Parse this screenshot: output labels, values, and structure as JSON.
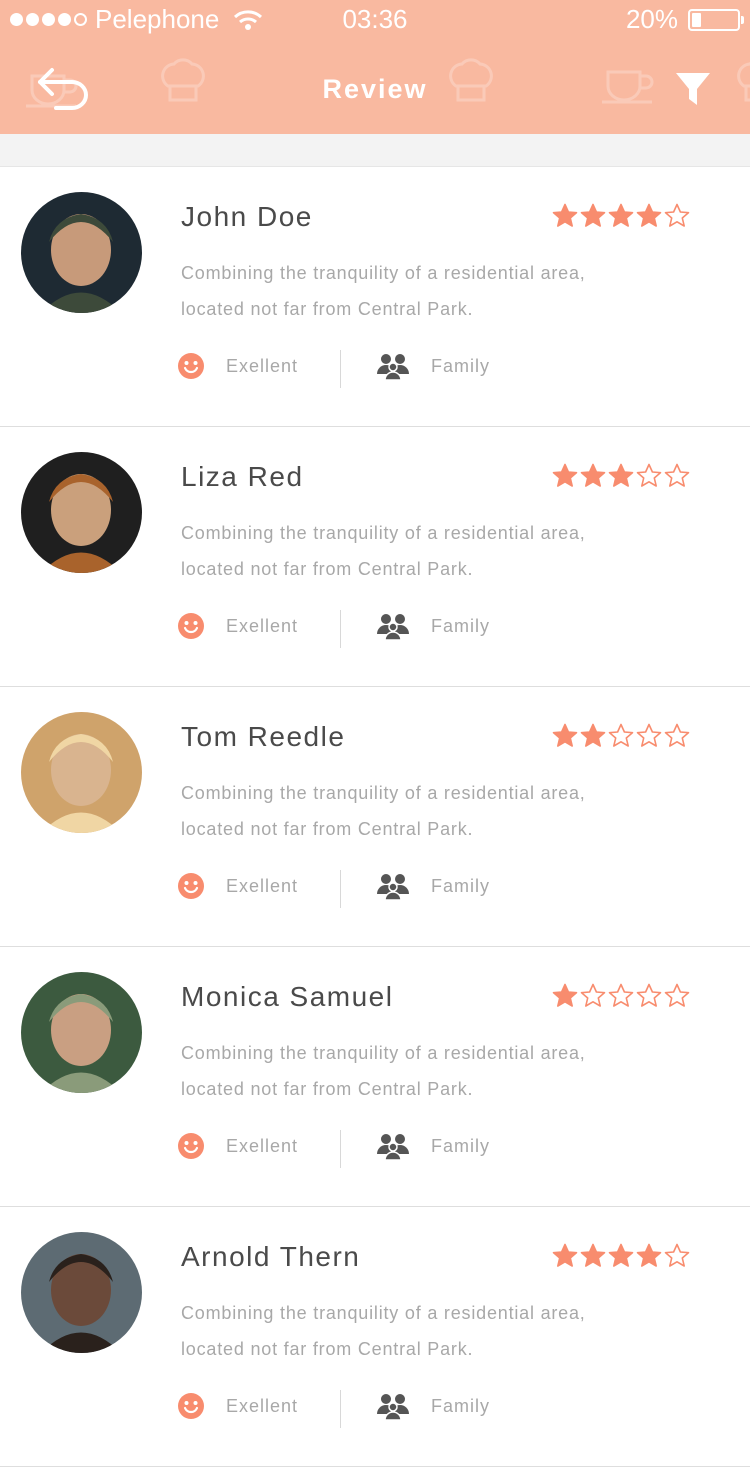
{
  "status_bar": {
    "carrier": "Pelephone",
    "time": "03:36",
    "battery": "20%",
    "battery_level": 0.2,
    "signal_dots_filled": 4,
    "signal_dots_total": 5
  },
  "header": {
    "title": "Review",
    "back_icon": "back-arrow-icon",
    "filter_icon": "filter-icon"
  },
  "colors": {
    "header_bg": "#f9b9a0",
    "accent": "#f88c6e",
    "text_dark": "#4a4a4a",
    "text_muted": "#a8a8a8"
  },
  "reviews": [
    {
      "name": "John Doe",
      "rating": 4,
      "description": "Combining the tranquility of a residential area, located not far from Central Park.",
      "mood": "Exellent",
      "group": "Family"
    },
    {
      "name": "Liza Red",
      "rating": 3,
      "description": "Combining the tranquility of a residential area, located not far from Central Park.",
      "mood": "Exellent",
      "group": "Family"
    },
    {
      "name": "Tom Reedle",
      "rating": 2,
      "description": "Combining the tranquility of a residential area, located not far from Central Park.",
      "mood": "Exellent",
      "group": "Family"
    },
    {
      "name": "Monica Samuel",
      "rating": 1,
      "description": "Combining the tranquility of a residential area, located not far from Central Park.",
      "mood": "Exellent",
      "group": "Family"
    },
    {
      "name": "Arnold Thern",
      "rating": 4,
      "description": "Combining the tranquility of a residential area, located not far from Central Park.",
      "mood": "Exellent",
      "group": "Family"
    }
  ]
}
